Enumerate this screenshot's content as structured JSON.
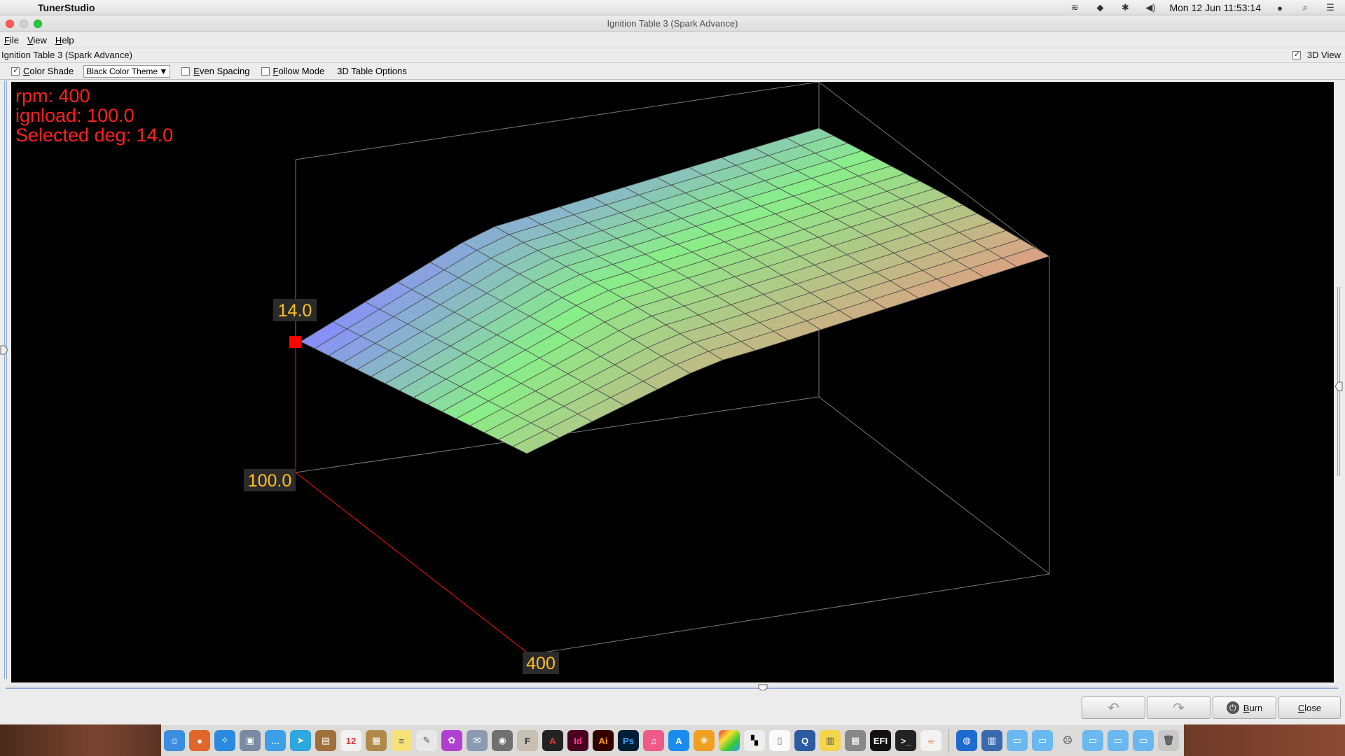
{
  "menubar": {
    "app_name": "TunerStudio",
    "clock": "Mon 12 Jun  11:53:14"
  },
  "window": {
    "title": "Ignition Table 3 (Spark Advance)"
  },
  "menu": {
    "items": [
      "File",
      "View",
      "Help"
    ]
  },
  "panel": {
    "title": "Ignition Table 3 (Spark Advance)",
    "view3d_label": "3D View",
    "view3d_checked": true
  },
  "toolbar": {
    "color_shade_label": "Color Shade",
    "color_shade_checked": true,
    "theme_selected": "Black Color Theme",
    "even_spacing_label": "Even Spacing",
    "follow_mode_label": "Follow Mode",
    "table_options_label": "3D Table Options"
  },
  "readout": {
    "rpm": "rpm: 400",
    "load": "ignload: 100.0",
    "selected": "Selected deg: 14.0"
  },
  "axis_labels": {
    "value": "14.0",
    "load": "100.0",
    "rpm": "400"
  },
  "buttons": {
    "burn_label": "Burn",
    "close_label": "Close"
  },
  "colors": {
    "readout": "#ff2020",
    "axis_label": "#ffc020",
    "selected_cell": "#ff0000",
    "surface_low": "#8888ff",
    "surface_mid": "#88ee88",
    "surface_high": "#ff8080"
  }
}
